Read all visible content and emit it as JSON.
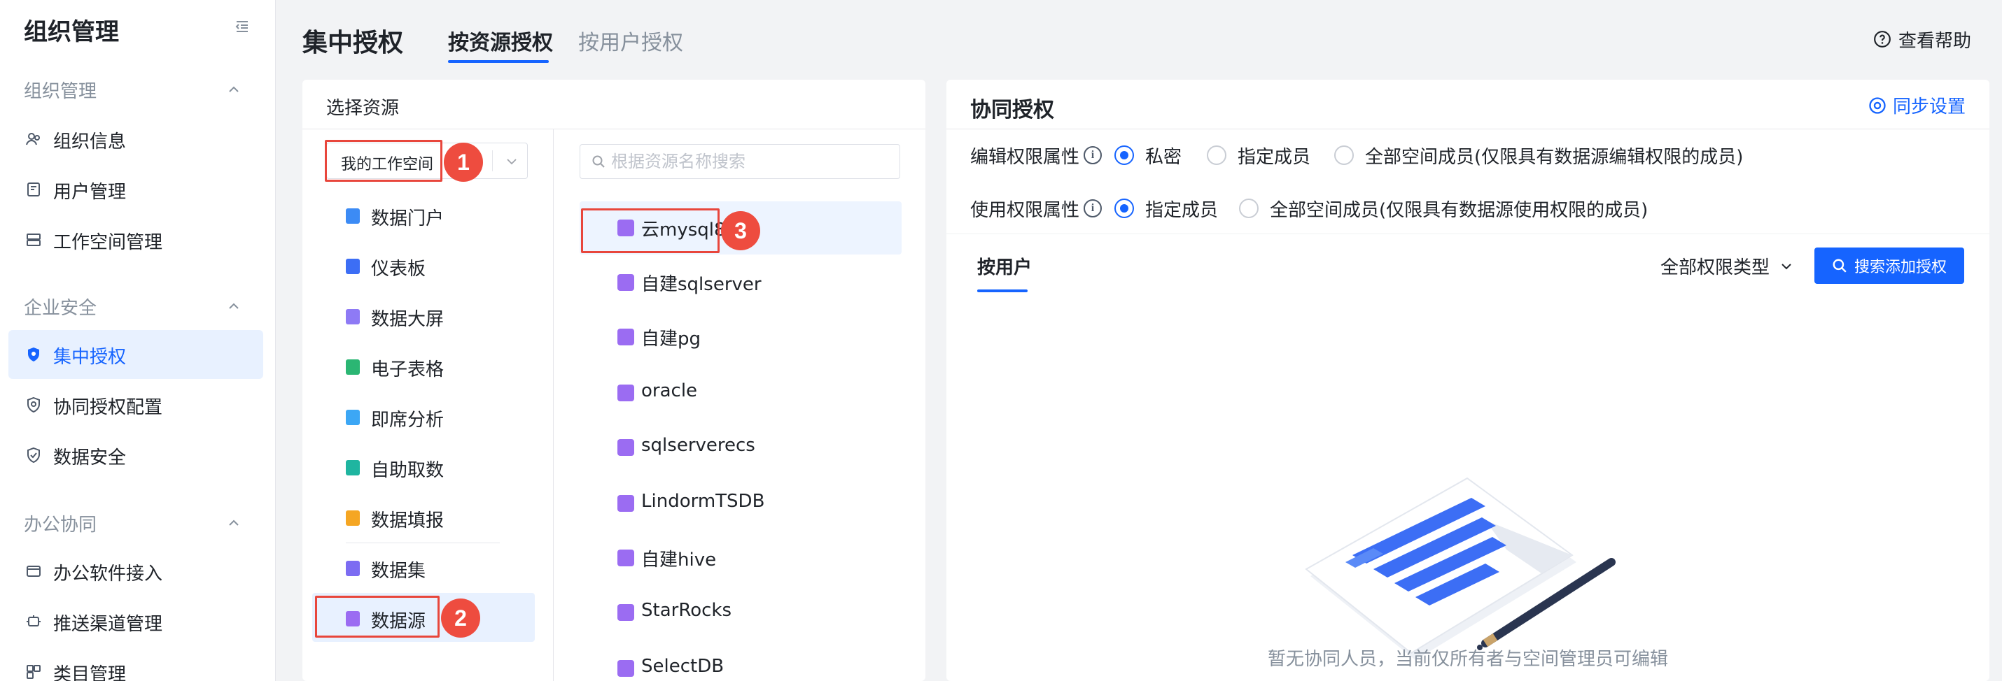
{
  "sidebar": {
    "title": "组织管理",
    "groups": [
      {
        "label": "组织管理"
      },
      {
        "label": "企业安全"
      },
      {
        "label": "办公协同"
      }
    ],
    "items": [
      {
        "label": "组织信息",
        "icon": "org-icon"
      },
      {
        "label": "用户管理",
        "icon": "user-icon"
      },
      {
        "label": "工作空间管理",
        "icon": "workspace-icon"
      },
      {
        "label": "集中授权",
        "icon": "shield-icon",
        "active": true
      },
      {
        "label": "协同授权配置",
        "icon": "shield-settings-icon"
      },
      {
        "label": "数据安全",
        "icon": "shield-check-icon"
      },
      {
        "label": "办公软件接入",
        "icon": "office-icon"
      },
      {
        "label": "推送渠道管理",
        "icon": "push-icon"
      },
      {
        "label": "类目管理",
        "icon": "category-icon"
      }
    ]
  },
  "header": {
    "title": "集中授权",
    "tabs": [
      {
        "label": "按资源授权",
        "active": true
      },
      {
        "label": "按用户授权"
      }
    ],
    "help": "查看帮助"
  },
  "left_panel": {
    "title": "选择资源",
    "workspace": "我的工作空间",
    "categories": [
      {
        "label": "数据门户",
        "color": "#3c8bf5"
      },
      {
        "label": "仪表板",
        "color": "#3c6ef5"
      },
      {
        "label": "数据大屏",
        "color": "#8e7af5"
      },
      {
        "label": "电子表格",
        "color": "#2bb673"
      },
      {
        "label": "即席分析",
        "color": "#3ca7f5"
      },
      {
        "label": "自助取数",
        "color": "#1fb5a0"
      },
      {
        "label": "数据填报",
        "color": "#f5a623"
      },
      {
        "label": "数据集",
        "color": "#7c6cf2"
      },
      {
        "label": "数据源",
        "color": "#9b6cf2",
        "active": true
      }
    ],
    "search_placeholder": "根据资源名称搜索",
    "resources": [
      {
        "label": "云mysql80",
        "active": true
      },
      {
        "label": "自建sqlserver"
      },
      {
        "label": "自建pg"
      },
      {
        "label": "oracle"
      },
      {
        "label": "sqlserverecs"
      },
      {
        "label": "LindormTSDB"
      },
      {
        "label": "自建hive"
      },
      {
        "label": "StarRocks"
      },
      {
        "label": "SelectDB"
      }
    ]
  },
  "badges": [
    "1",
    "2",
    "3"
  ],
  "right_panel": {
    "title": "协同授权",
    "sync_label": "同步设置",
    "edit_perm_label": "编辑权限属性",
    "edit_options": [
      "私密",
      "指定成员",
      "全部空间成员(仅限具有数据源编辑权限的成员)"
    ],
    "use_perm_label": "使用权限属性",
    "use_options": [
      "指定成员",
      "全部空间成员(仅限具有数据源使用权限的成员)"
    ],
    "sub_tab": "按用户",
    "perm_type": "全部权限类型",
    "add_button": "搜索添加授权",
    "empty_text": "暂无协同人员，当前仅所有者与空间管理员可编辑"
  },
  "colors": {
    "primary": "#1664ff",
    "highlight": "#e8463c",
    "datasource": "#9b6cf2"
  }
}
